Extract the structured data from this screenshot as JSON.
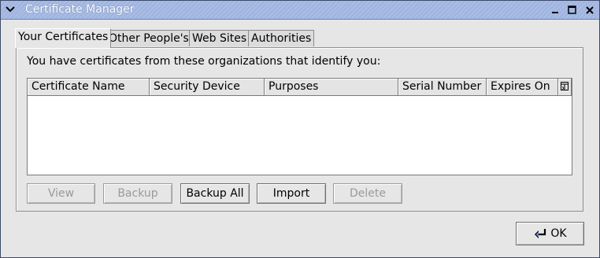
{
  "window": {
    "title": "Certificate Manager",
    "menu_icon": "chevron-down-icon",
    "controls": [
      "minimize-icon",
      "maximize-icon",
      "close-icon"
    ]
  },
  "tabs": [
    {
      "label": "Your Certificates",
      "active": true
    },
    {
      "label": "Other People's",
      "active": false
    },
    {
      "label": "Web Sites",
      "active": false
    },
    {
      "label": "Authorities",
      "active": false
    }
  ],
  "panel": {
    "intro": "You have certificates from these organizations that identify you:",
    "table": {
      "columns": [
        "Certificate Name",
        "Security Device",
        "Purposes",
        "Serial Number",
        "Expires On"
      ],
      "column_picker_icon": "column-picker-icon",
      "rows": []
    },
    "buttons": [
      {
        "label": "View",
        "enabled": false
      },
      {
        "label": "Backup",
        "enabled": false
      },
      {
        "label": "Backup All",
        "enabled": true
      },
      {
        "label": "Import",
        "enabled": true
      },
      {
        "label": "Delete",
        "enabled": false
      }
    ]
  },
  "footer": {
    "ok_label": "OK",
    "ok_icon": "enter-arrow-icon"
  }
}
